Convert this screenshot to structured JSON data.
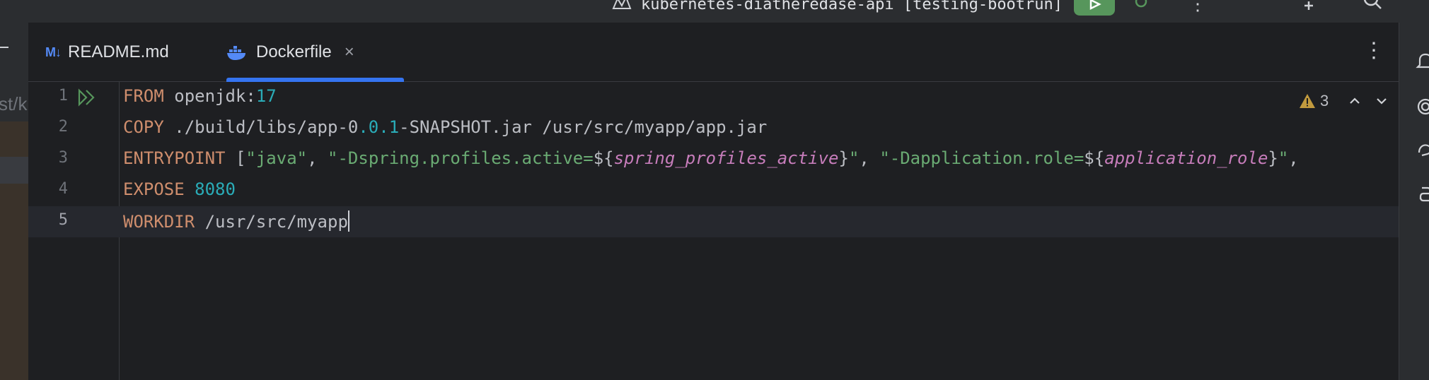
{
  "titlebar": {
    "project_title": "kubernetes-diatheredase-api [testing-bootrun]",
    "icons": [
      "project-icon",
      "run-icon",
      "debug-icon",
      "more-icon",
      "add-user-icon",
      "search-icon"
    ]
  },
  "sidebar": {
    "path_fragment": "st/k"
  },
  "tabs": [
    {
      "icon": "markdown-icon",
      "icon_text": "M↓",
      "label": "README.md",
      "active": false
    },
    {
      "icon": "docker-icon",
      "label": "Dockerfile",
      "active": true,
      "close": "×"
    }
  ],
  "inspections": {
    "warning_count": "3",
    "icons": [
      "warning-icon",
      "chevron-up-icon",
      "chevron-down-icon"
    ]
  },
  "editor": {
    "language": "Dockerfile",
    "current_line": 5,
    "lines": [
      {
        "number": "1",
        "text": "FROM openjdk:17"
      },
      {
        "number": "2",
        "text": "COPY ./build/libs/app-0.0.1-SNAPSHOT.jar /usr/src/myapp/app.jar"
      },
      {
        "number": "3",
        "text": "ENTRYPOINT [\"java\", \"-Dspring.profiles.active=${spring_profiles_active}\", \"-Dapplication.role=${application_role}\","
      },
      {
        "number": "4",
        "text": "EXPOSE 8080"
      },
      {
        "number": "5",
        "text": "WORKDIR /usr/src/myapp"
      }
    ],
    "tokens": {
      "l1": {
        "kw": "FROM",
        "a": " openjdk:",
        "num": "17"
      },
      "l2": {
        "kw": "COPY",
        "a": " ./build/libs/app-0",
        "n1": ".0.1",
        "b": "-SNAPSHOT.jar /usr/src/myapp/app.jar"
      },
      "l3": {
        "kw": "ENTRYPOINT",
        "a": " [",
        "s1": "\"java\"",
        "c": ", ",
        "s2a": "\"-Dspring.profiles.active=",
        "d1": "${",
        "v1": "spring_profiles_active",
        "d2": "}",
        "s2b": "\"",
        "c2": ", ",
        "s3a": "\"-Dapplication.role=",
        "d3": "${",
        "v2": "application_role",
        "d4": "}",
        "s3b": "\"",
        "c3": ","
      },
      "l4": {
        "kw": "EXPOSE",
        "a": " ",
        "num": "8080"
      },
      "l5": {
        "kw": "WORKDIR",
        "a": " /usr/src/myapp"
      }
    }
  },
  "colors": {
    "background": "#1e1f22",
    "keyword": "#cf8e6d",
    "number": "#2aacb8",
    "string": "#6aab73",
    "template_var": "#c77dbb",
    "accent": "#3574f0",
    "run_green": "#57965c"
  }
}
